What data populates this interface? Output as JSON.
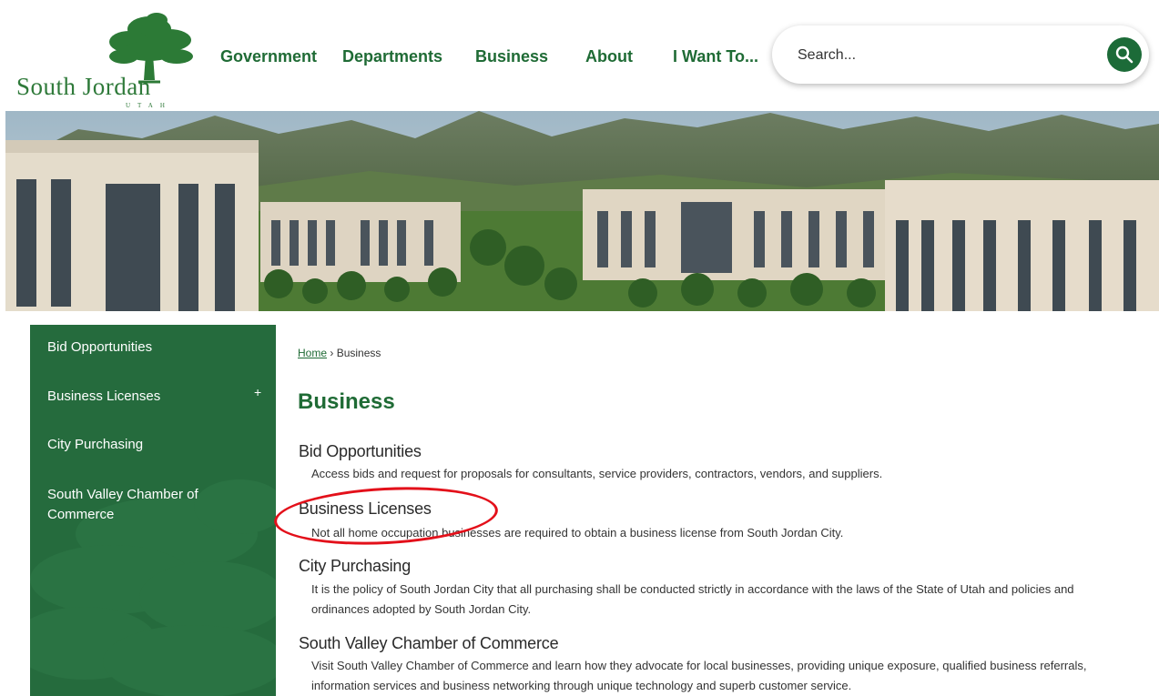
{
  "logo": {
    "name": "South Jordan",
    "sub": "UTAH"
  },
  "nav": {
    "items": [
      "Government",
      "Departments",
      "Business",
      "About",
      "I Want To..."
    ]
  },
  "search": {
    "placeholder": "Search..."
  },
  "sidebar": {
    "items": [
      {
        "label": "Bid Opportunities"
      },
      {
        "label": "Business Licenses",
        "expand": "+"
      },
      {
        "label": "City Purchasing"
      },
      {
        "label": "South Valley Chamber of Commerce"
      }
    ]
  },
  "breadcrumb": {
    "home": "Home",
    "separator": "›",
    "current": "Business"
  },
  "page": {
    "title": "Business"
  },
  "entries": [
    {
      "title": "Bid Opportunities",
      "desc": "Access bids and request for proposals for consultants, service providers, contractors, vendors, and suppliers."
    },
    {
      "title": "Business Licenses",
      "desc": "Not all home occupation businesses are required to obtain a business license from South Jordan City."
    },
    {
      "title": "City Purchasing",
      "desc": "It is the policy of South Jordan City that all purchasing shall be conducted strictly in accordance with the laws of the State of Utah and policies and ordinances adopted by South Jordan City."
    },
    {
      "title": "South Valley Chamber of Commerce",
      "desc": "Visit South Valley Chamber of Commerce and learn how they advocate for local businesses, providing unique exposure, qualified business referrals, information services and business networking through unique technology and superb customer service."
    }
  ],
  "colors": {
    "brand_green": "#1f6b35",
    "sidebar_green": "#256b3d",
    "annotation_red": "#e3101a"
  },
  "icons": {
    "search": "search-icon",
    "logo": "tree-icon"
  }
}
